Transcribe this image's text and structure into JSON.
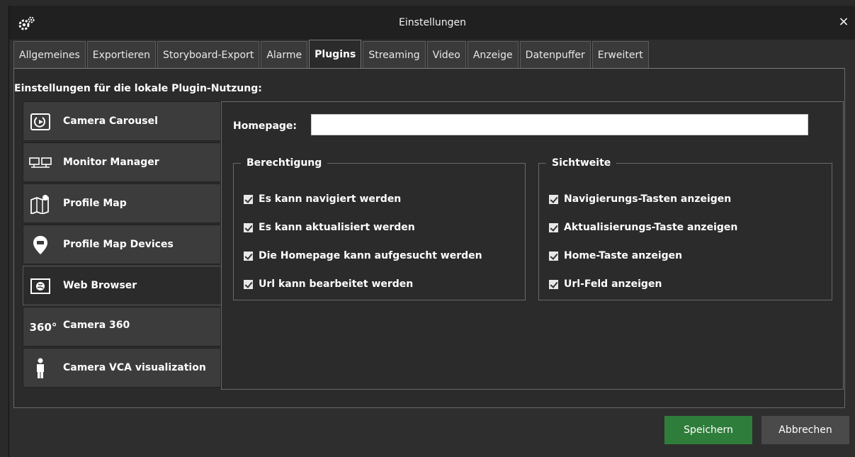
{
  "window": {
    "title": "Einstellungen",
    "close_glyph": "×",
    "icons": {
      "title_icon": "gears-icon",
      "close_icon": "close-icon"
    }
  },
  "tabs": [
    {
      "label": "Allgemeines",
      "active": false
    },
    {
      "label": "Exportieren",
      "active": false
    },
    {
      "label": "Storyboard-Export",
      "active": false
    },
    {
      "label": "Alarme",
      "active": false
    },
    {
      "label": "Plugins",
      "active": true
    },
    {
      "label": "Streaming",
      "active": false
    },
    {
      "label": "Video",
      "active": false
    },
    {
      "label": "Anzeige",
      "active": false
    },
    {
      "label": "Datenpuffer",
      "active": false
    },
    {
      "label": "Erweitert",
      "active": false
    }
  ],
  "section_label": "Einstellungen für die lokale Plugin-Nutzung:",
  "plugins": [
    {
      "label": "Camera Carousel",
      "icon": "camera-carousel-icon",
      "active": false
    },
    {
      "label": "Monitor Manager",
      "icon": "monitor-manager-icon",
      "active": false
    },
    {
      "label": "Profile Map",
      "icon": "profile-map-icon",
      "active": false
    },
    {
      "label": "Profile Map Devices",
      "icon": "map-pin-icon",
      "active": false
    },
    {
      "label": "Web Browser",
      "icon": "globe-icon",
      "active": true
    },
    {
      "label": "Camera 360",
      "icon": "camera-360-icon",
      "active": false
    },
    {
      "label": "Camera VCA visualization",
      "icon": "person-icon",
      "active": false
    }
  ],
  "homepage": {
    "label": "Homepage:",
    "value": ""
  },
  "berechtigung": {
    "legend": "Berechtigung",
    "items": [
      {
        "label": "Es kann navigiert werden",
        "checked": true
      },
      {
        "label": "Es kann aktualisiert werden",
        "checked": true
      },
      {
        "label": "Die Homepage kann aufgesucht werden",
        "checked": true
      },
      {
        "label": "Url kann bearbeitet werden",
        "checked": true
      }
    ]
  },
  "sichtweite": {
    "legend": "Sichtweite",
    "items": [
      {
        "label": "Navigierungs-Tasten anzeigen",
        "checked": true
      },
      {
        "label": "Aktualisierungs-Taste anzeigen",
        "checked": true
      },
      {
        "label": "Home-Taste anzeigen",
        "checked": true
      },
      {
        "label": "Url-Feld anzeigen",
        "checked": true
      }
    ]
  },
  "buttons": {
    "save": "Speichern",
    "cancel": "Abbrechen"
  },
  "colors": {
    "save": "#2f7d3a",
    "cancel": "#4a4a4a",
    "title_bar": "#202020"
  }
}
